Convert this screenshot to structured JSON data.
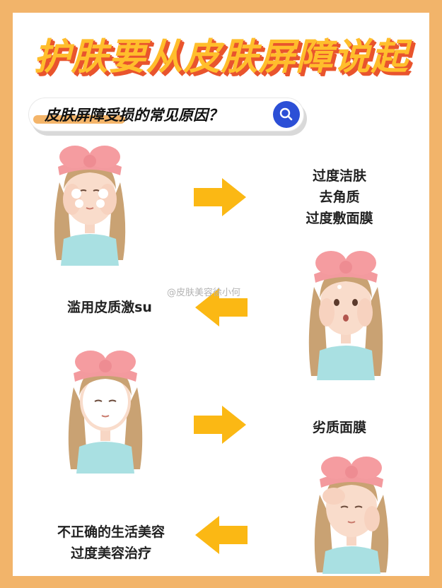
{
  "title": "护肤要从皮肤屏障说起",
  "question": "皮肤屏障受损的常见原因？",
  "colors": {
    "border": "#f2b46a",
    "title_fill": "#ffbe2c",
    "title_shadow": "#e9542d",
    "arrow": "#fbb814",
    "search_button": "#2c4fd6"
  },
  "items": [
    {
      "lines": [
        "过度洁肤",
        "去角质",
        "过度敷面膜"
      ]
    },
    {
      "lines": [
        "滥用皮质激su"
      ]
    },
    {
      "lines": [
        "劣质面膜"
      ]
    },
    {
      "lines": [
        "不正确的生活美容",
        "过度美容治疗"
      ]
    }
  ],
  "watermark": "@皮肤美容徐小何"
}
